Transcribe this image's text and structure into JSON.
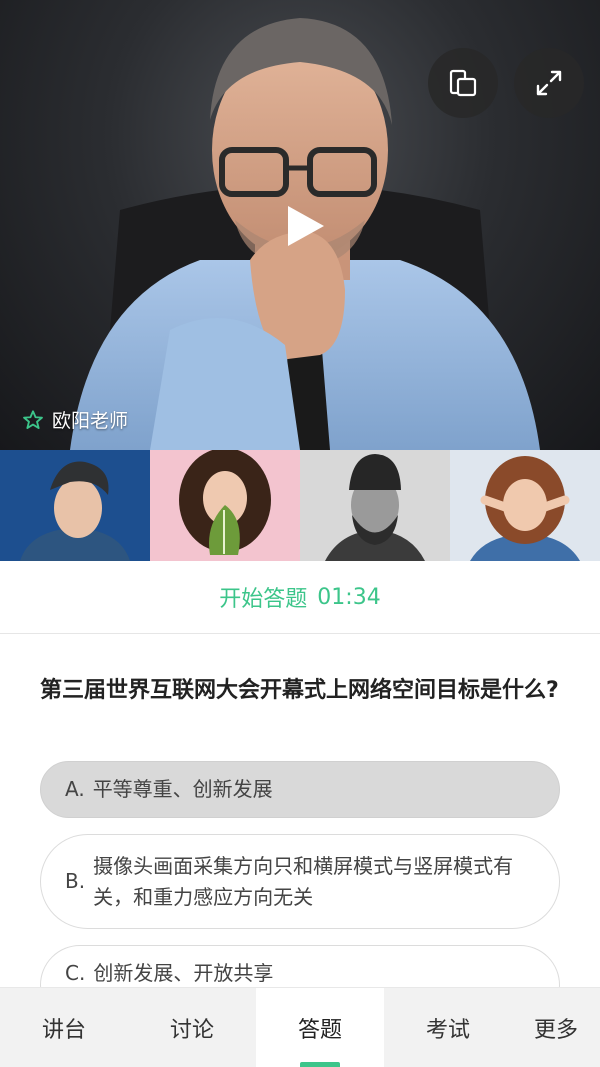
{
  "video": {
    "teacher_name": "欧阳老师",
    "icons": {
      "layout": "layout-switch-icon",
      "fullscreen": "fullscreen-icon",
      "play": "play-icon",
      "favorite": "star-outline-icon"
    }
  },
  "students": [
    {
      "name": "student-1"
    },
    {
      "name": "student-2"
    },
    {
      "name": "student-3"
    },
    {
      "name": "student-4"
    }
  ],
  "answer": {
    "title": "开始答题",
    "timer": "01:34"
  },
  "question": {
    "text": "第三届世界互联网大会开幕式上网络空间目标是什么?",
    "options": [
      {
        "key": "A.",
        "text": "平等尊重、创新发展",
        "selected": true
      },
      {
        "key": "B.",
        "text": "摄像头画面采集方向只和横屏模式与竖屏模式有关，和重力感应方向无关",
        "selected": false
      },
      {
        "key": "C.",
        "text": "创新发展、开放共享",
        "selected": false
      }
    ]
  },
  "tabs": [
    {
      "label": "讲台"
    },
    {
      "label": "讨论"
    },
    {
      "label": "答题",
      "active": true
    },
    {
      "label": "考试"
    },
    {
      "label": "更多"
    }
  ],
  "colors": {
    "accent": "#3cc58a",
    "selected_option_bg": "#d9d9d9",
    "tabbar_bg": "#f2f2f2"
  }
}
